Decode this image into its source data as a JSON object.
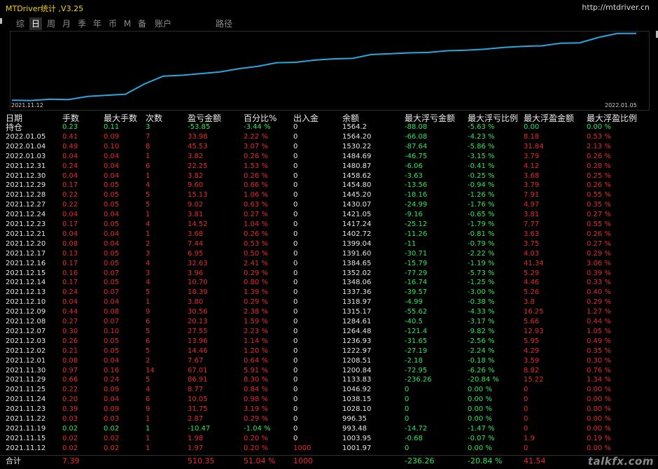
{
  "app": {
    "title": "MTDriver统计 ,V3.25",
    "url": "http://mtdriver.cn"
  },
  "tabs": [
    "综",
    "日",
    "周",
    "月",
    "季",
    "年",
    "币",
    "M",
    "备",
    "账户",
    "路径"
  ],
  "active_tab": "日",
  "chart_data": {
    "type": "line",
    "x_start_label": "2021.11.12",
    "x_end_label": "2022.01.05",
    "color": "#2aa6e0",
    "values": [
      996.35,
      993.48,
      1003.95,
      1001.97,
      1028.1,
      1038.15,
      1046.92,
      1133.83,
      1200.84,
      1208.51,
      1222.97,
      1236.93,
      1264.48,
      1284.61,
      1315.17,
      1318.97,
      1337.36,
      1348.06,
      1352.02,
      1384.65,
      1391.6,
      1399.04,
      1402.72,
      1417.24,
      1421.05,
      1430.07,
      1445.2,
      1454.8,
      1458.62,
      1480.87,
      1484.69,
      1530.22,
      1564.2,
      1564.2
    ]
  },
  "headers": [
    "日期",
    "手数",
    "最大手数",
    "次数",
    "盈亏金额",
    "百分比%",
    "出入金",
    "余额",
    "最大浮亏金额",
    "最大浮亏比例",
    "最大浮盈金额",
    "最大浮盈比例"
  ],
  "holding": [
    "持仓",
    "0.23",
    "0.11",
    "3",
    "-53.85",
    "-3.44 %",
    "0",
    "1564.2",
    "-88.08",
    "-5.63 %",
    "0.00",
    "0.00 %"
  ],
  "rows": [
    [
      "2022.01.05",
      "0.41",
      "0.09",
      "7",
      "33.98",
      "2.22 %",
      "0",
      "1564.20",
      "-66.08",
      "-4.23 %",
      "8.18",
      "0.53 %"
    ],
    [
      "2022.01.04",
      "0.49",
      "0.10",
      "8",
      "45.53",
      "3.07 %",
      "0",
      "1530.22",
      "-87.64",
      "-5.86 %",
      "31.84",
      "2.13 %"
    ],
    [
      "2022.01.03",
      "0.04",
      "0.04",
      "1",
      "3.82",
      "0.26 %",
      "0",
      "1484.69",
      "-46.75",
      "-3.15 %",
      "3.79",
      "0.26 %"
    ],
    [
      "2021.12.31",
      "0.24",
      "0.04",
      "6",
      "22.25",
      "1.53 %",
      "0",
      "1480.87",
      "-6.06",
      "-0.41 %",
      "4.12",
      "0.28 %"
    ],
    [
      "2021.12.30",
      "0.04",
      "0.04",
      "1",
      "3.82",
      "0.26 %",
      "0",
      "1458.62",
      "-3.63",
      "-0.25 %",
      "3.68",
      "0.25 %"
    ],
    [
      "2021.12.29",
      "0.17",
      "0.05",
      "4",
      "9.60",
      "0.66 %",
      "0",
      "1454.80",
      "-13.56",
      "-0.94 %",
      "3.79",
      "0.26 %"
    ],
    [
      "2021.12.28",
      "0.22",
      "0.05",
      "5",
      "15.13",
      "1.06 %",
      "0",
      "1445.20",
      "-18.16",
      "-1.26 %",
      "7.91",
      "0.55 %"
    ],
    [
      "2021.12.27",
      "0.22",
      "0.05",
      "5",
      "9.02",
      "0.63 %",
      "0",
      "1430.07",
      "-24.99",
      "-1.76 %",
      "4.97",
      "0.35 %"
    ],
    [
      "2021.12.24",
      "0.04",
      "0.04",
      "1",
      "3.81",
      "0.27 %",
      "0",
      "1421.05",
      "-9.16",
      "-0.65 %",
      "3.81",
      "0.27 %"
    ],
    [
      "2021.12.23",
      "0.17",
      "0.05",
      "4",
      "14.52",
      "1.04 %",
      "0",
      "1417.24",
      "-25.12",
      "-1.79 %",
      "7.77",
      "0.55 %"
    ],
    [
      "2021.12.21",
      "0.04",
      "0.04",
      "1",
      "3.68",
      "0.26 %",
      "0",
      "1402.72",
      "-11.26",
      "-0.81 %",
      "3.63",
      "0.26 %"
    ],
    [
      "2021.12.20",
      "0.08",
      "0.04",
      "2",
      "7.44",
      "0.53 %",
      "0",
      "1399.04",
      "-11",
      "-0.79 %",
      "3.75",
      "0.27 %"
    ],
    [
      "2021.12.17",
      "0.13",
      "0.05",
      "3",
      "6.95",
      "0.50 %",
      "0",
      "1391.60",
      "-30.71",
      "-2.22 %",
      "4.03",
      "0.29 %"
    ],
    [
      "2021.12.16",
      "0.17",
      "0.05",
      "4",
      "32.63",
      "2.41 %",
      "0",
      "1384.65",
      "-15.79",
      "-1.19 %",
      "41.34",
      "3.06 %"
    ],
    [
      "2021.12.15",
      "0.16",
      "0.07",
      "3",
      "3.96",
      "0.29 %",
      "0",
      "1352.02",
      "-77.29",
      "-5.73 %",
      "5.29",
      "0.39 %"
    ],
    [
      "2021.12.14",
      "0.17",
      "0.05",
      "4",
      "10.70",
      "0.80 %",
      "0",
      "1348.06",
      "-16.74",
      "-1.25 %",
      "4.46",
      "0.33 %"
    ],
    [
      "2021.12.13",
      "0.24",
      "0.07",
      "5",
      "18.39",
      "1.39 %",
      "0",
      "1337.36",
      "-39.57",
      "-3.00 %",
      "5.26",
      "0.40 %"
    ],
    [
      "2021.12.10",
      "0.04",
      "0.04",
      "1",
      "3.80",
      "0.29 %",
      "0",
      "1318.97",
      "-4.99",
      "-0.38 %",
      "3.8",
      "0.29 %"
    ],
    [
      "2021.12.09",
      "0.44",
      "0.08",
      "9",
      "30.56",
      "2.38 %",
      "0",
      "1315.17",
      "-55.62",
      "-4.33 %",
      "16.25",
      "1.27 %"
    ],
    [
      "2021.12.08",
      "0.27",
      "0.07",
      "6",
      "20.13",
      "1.59 %",
      "0",
      "1284.61",
      "-40.5",
      "-3.17 %",
      "5.66",
      "0.44 %"
    ],
    [
      "2021.12.07",
      "0.30",
      "0.10",
      "5",
      "27.55",
      "2.23 %",
      "0",
      "1264.48",
      "-121.4",
      "-9.82 %",
      "12.93",
      "1.05 %"
    ],
    [
      "2021.12.03",
      "0.26",
      "0.05",
      "6",
      "13.96",
      "1.14 %",
      "0",
      "1236.93",
      "-31.65",
      "-2.56 %",
      "5.95",
      "0.49 %"
    ],
    [
      "2021.12.02",
      "0.21",
      "0.05",
      "5",
      "14.46",
      "1.20 %",
      "0",
      "1222.97",
      "-27.19",
      "-2.24 %",
      "4.29",
      "0.35 %"
    ],
    [
      "2021.12.01",
      "0.08",
      "0.04",
      "2",
      "7.67",
      "0.64 %",
      "0",
      "1208.51",
      "-2.18",
      "-0.18 %",
      "3.59",
      "0.30 %"
    ],
    [
      "2021.11.30",
      "0.97",
      "0.16",
      "14",
      "67.01",
      "5.91 %",
      "0",
      "1200.84",
      "-72.95",
      "-6.26 %",
      "8.82",
      "0.76 %"
    ],
    [
      "2021.11.29",
      "0.66",
      "0.24",
      "5",
      "86.91",
      "8.30 %",
      "0",
      "1133.83",
      "-236.26",
      "-20.84 %",
      "15.22",
      "1.34 %"
    ],
    [
      "2021.11.25",
      "0.22",
      "0.09",
      "4",
      "8.77",
      "0.84 %",
      "0",
      "1046.92",
      "0",
      "0.00 %",
      "0",
      "0.00 %"
    ],
    [
      "2021.11.24",
      "0.20",
      "0.04",
      "6",
      "10.05",
      "0.98 %",
      "0",
      "1038.15",
      "0",
      "0.00 %",
      "0",
      "0.00 %"
    ],
    [
      "2021.11.23",
      "0.39",
      "0.09",
      "9",
      "31.75",
      "3.19 %",
      "0",
      "1028.10",
      "0",
      "0.00 %",
      "0",
      "0.00 %"
    ],
    [
      "2021.11.22",
      "0.03",
      "0.03",
      "1",
      "2.87",
      "0.29 %",
      "0",
      "996.35",
      "0",
      "0.00 %",
      "0",
      "0.00 %"
    ],
    [
      "2021.11.19",
      "0.02",
      "0.02",
      "1",
      "-10.47",
      "-1.04 %",
      "0",
      "993.48",
      "-14.72",
      "-1.47 %",
      "0",
      "0.00 %"
    ],
    [
      "2021.11.15",
      "0.02",
      "0.02",
      "1",
      "1.98",
      "0.20 %",
      "0",
      "1003.95",
      "-0.68",
      "-0.07 %",
      "1.9",
      "0.19 %"
    ],
    [
      "2021.11.12",
      "0.02",
      "0.02",
      "1",
      "1.97",
      "0.20 %",
      "1000",
      "1001.97",
      "0",
      "0.00 %",
      "0",
      "0.00 %"
    ]
  ],
  "total": [
    "合计",
    "7.39",
    "",
    "",
    "510.35",
    "51.04 %",
    "1000",
    "",
    "-236.26",
    "-20.84 %",
    "41.54",
    ""
  ],
  "watermark": "talkfx.com",
  "colors": {
    "profit": "#e52b2b",
    "loss": "#2ee65a",
    "neutral": "#e6e6e6",
    "title": "#f2d21b",
    "line": "#2aa6e0"
  }
}
